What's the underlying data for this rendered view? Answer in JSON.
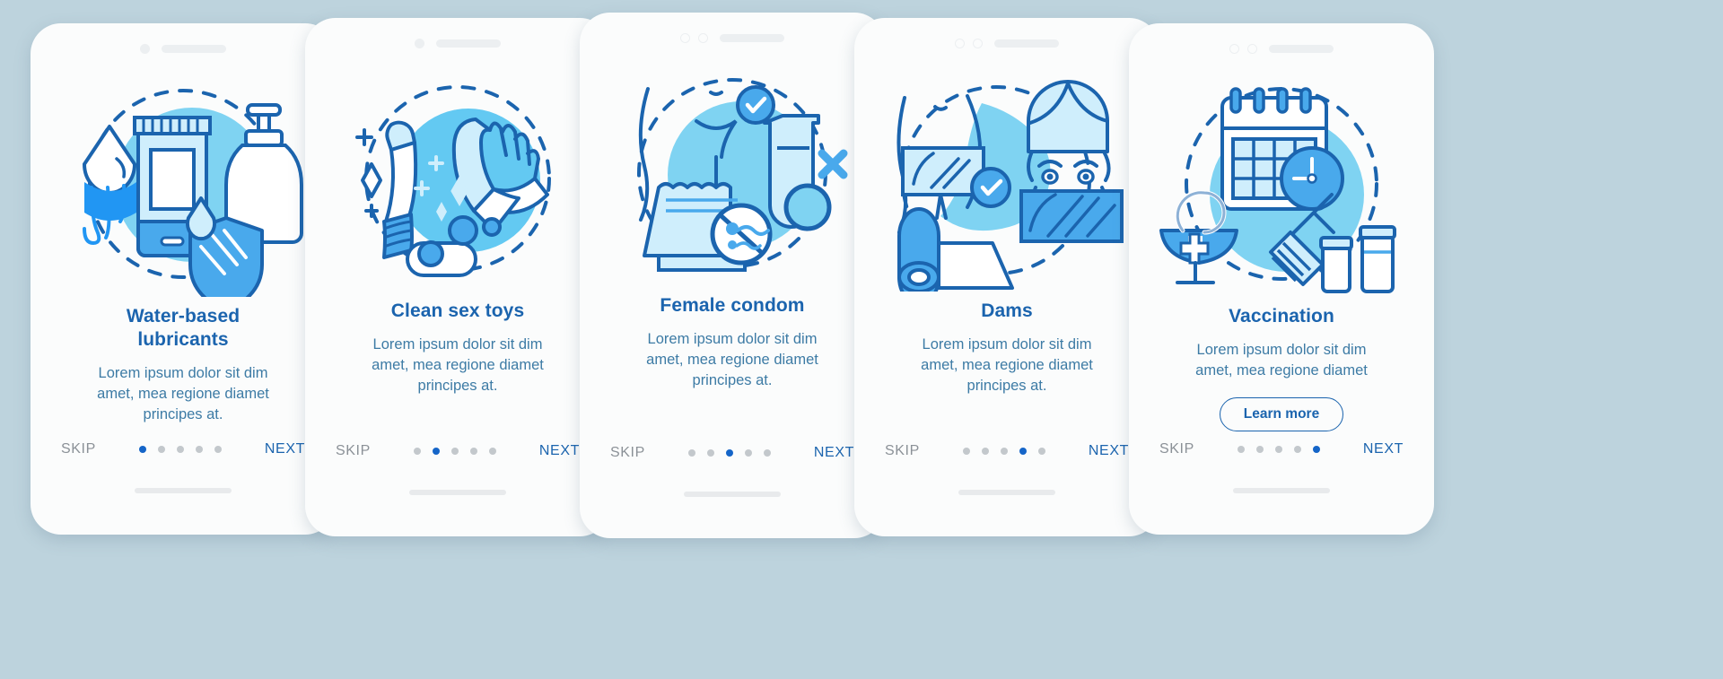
{
  "page": {
    "background_color": "#bdd3dd",
    "accent_color": "#1b64ae",
    "dot_active_color": "#1565c8",
    "dot_inactive_color": "#c3c8cc",
    "body_text_color": "#3d7ba5",
    "skip_color": "#8b9197"
  },
  "screens": [
    {
      "title": "Water-based lubricants",
      "title_line1": "Water-based",
      "title_line2": "lubricants",
      "body": "Lorem ipsum dolor sit dim amet, mea regione diamet principes at.",
      "body_line1": "Lorem ipsum dolor sit dim",
      "body_line2": "amet, mea regione diamet",
      "body_line3": "principes at.",
      "skip_label": "SKIP",
      "next_label": "NEXT",
      "active_dot": 1,
      "dot_count": 5,
      "illustration": "water-based-lubricants-illustration",
      "has_learn_more": false,
      "learn_more_label": ""
    },
    {
      "title": "Clean sex toys",
      "title_line1": "Clean sex toys",
      "title_line2": "",
      "body": "Lorem ipsum dolor sit dim amet, mea regione diamet principes at.",
      "body_line1": "Lorem ipsum dolor sit dim",
      "body_line2": "amet, mea regione diamet",
      "body_line3": "principes at.",
      "skip_label": "SKIP",
      "next_label": "NEXT",
      "active_dot": 2,
      "dot_count": 5,
      "illustration": "clean-sex-toys-illustration",
      "has_learn_more": false,
      "learn_more_label": ""
    },
    {
      "title": "Female condom",
      "title_line1": "Female condom",
      "title_line2": "",
      "body": "Lorem ipsum dolor sit dim amet, mea regione diamet principes at.",
      "body_line1": "Lorem ipsum dolor sit dim",
      "body_line2": "amet, mea regione diamet",
      "body_line3": "principes at.",
      "skip_label": "SKIP",
      "next_label": "NEXT",
      "active_dot": 3,
      "dot_count": 5,
      "illustration": "female-condom-illustration",
      "has_learn_more": false,
      "learn_more_label": ""
    },
    {
      "title": "Dams",
      "title_line1": "Dams",
      "title_line2": "",
      "body": "Lorem ipsum dolor sit dim amet, mea regione diamet principes at.",
      "body_line1": "Lorem ipsum dolor sit dim",
      "body_line2": "amet, mea regione diamet",
      "body_line3": "principes at.",
      "skip_label": "SKIP",
      "next_label": "NEXT",
      "active_dot": 4,
      "dot_count": 5,
      "illustration": "dams-illustration",
      "has_learn_more": false,
      "learn_more_label": ""
    },
    {
      "title": "Vaccination",
      "title_line1": "Vaccination",
      "title_line2": "",
      "body": "Lorem ipsum dolor sit dim amet, mea regione diamet",
      "body_line1": "Lorem ipsum dolor sit dim",
      "body_line2": "amet, mea regione diamet",
      "body_line3": "",
      "skip_label": "SKIP",
      "next_label": "NEXT",
      "active_dot": 5,
      "dot_count": 5,
      "illustration": "vaccination-illustration",
      "has_learn_more": true,
      "learn_more_label": "Learn more"
    }
  ]
}
